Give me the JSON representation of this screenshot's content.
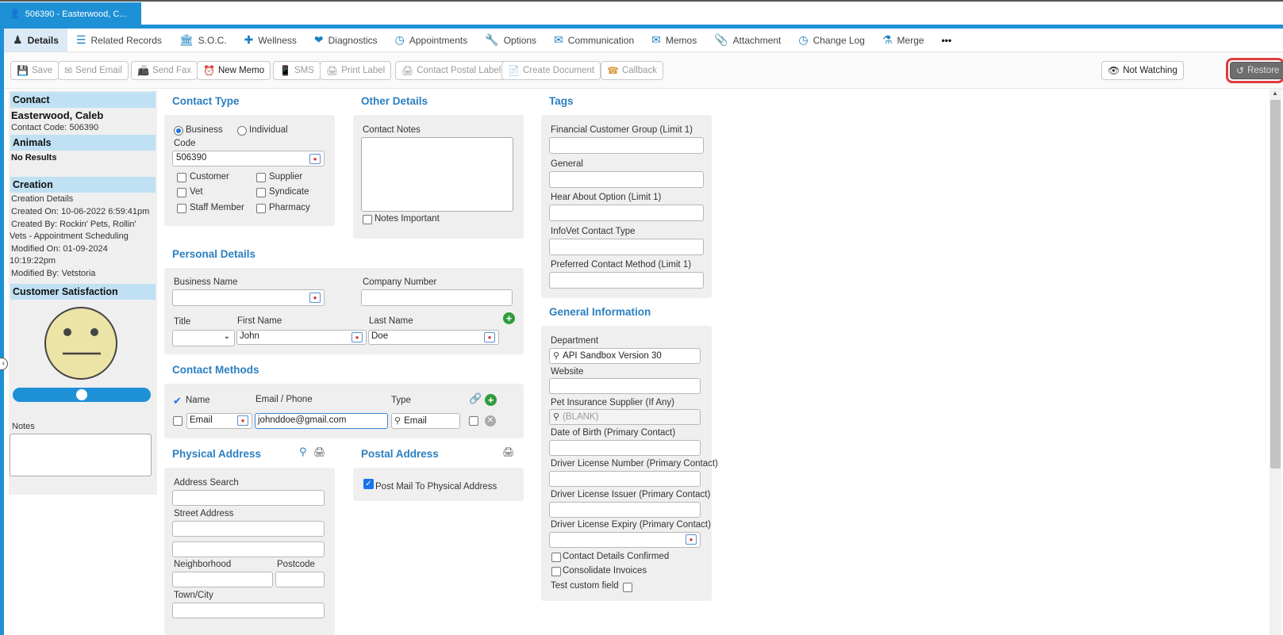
{
  "window": {
    "tab_title": "506390 - Easterwood, C..."
  },
  "nav": {
    "tabs": [
      {
        "label": "Details"
      },
      {
        "label": "Related Records"
      },
      {
        "label": "S.O.C."
      },
      {
        "label": "Wellness"
      },
      {
        "label": "Diagnostics"
      },
      {
        "label": "Appointments"
      },
      {
        "label": "Options"
      },
      {
        "label": "Communication"
      },
      {
        "label": "Memos"
      },
      {
        "label": "Attachment"
      },
      {
        "label": "Change Log"
      },
      {
        "label": "Merge"
      }
    ],
    "more": "•••"
  },
  "toolbar": {
    "save": "Save",
    "send_email": "Send Email",
    "send_fax": "Send Fax",
    "new_memo": "New Memo",
    "sms": "SMS",
    "print_label": "Print Label",
    "contact_postal_label": "Contact Postal Label",
    "create_document": "Create Document",
    "callback": "Callback",
    "not_watching": "Not Watching",
    "restore": "Restore"
  },
  "sidebar": {
    "contact_header": "Contact",
    "contact_name": "Easterwood, Caleb",
    "contact_code": "Contact Code: 506390",
    "animals_header": "Animals",
    "animals_value": "No Results",
    "creation_header": "Creation",
    "creation_lines": [
      "Creation Details",
      "Created On: 10-06-2022 6:59:41pm",
      "Created By: Rockin' Pets, Rollin'",
      "Vets - Appointment Scheduling",
      "Modified On: 01-09-2024",
      "10:19:22pm",
      "Modified By: Vetstoria"
    ],
    "satisfaction_header": "Customer Satisfaction",
    "satisfaction_level": 0.5,
    "notes_label": "Notes"
  },
  "contact_type": {
    "title": "Contact Type",
    "business": "Business",
    "individual": "Individual",
    "code_label": "Code",
    "code_value": "506390",
    "checkboxes": [
      "Customer",
      "Supplier",
      "Vet",
      "Syndicate",
      "Staff Member",
      "Pharmacy"
    ]
  },
  "other_details": {
    "title": "Other Details",
    "contact_notes_label": "Contact Notes",
    "notes_important": "Notes Important"
  },
  "tags": {
    "title": "Tags",
    "fields": [
      "Financial Customer Group (Limit 1)",
      "General",
      "Hear About Option (Limit 1)",
      "InfoVet Contact Type",
      "Preferred Contact Method (Limit 1)"
    ]
  },
  "personal": {
    "title": "Personal Details",
    "business_name": "Business Name",
    "company_number": "Company Number",
    "title_label": "Title",
    "first_name_label": "First Name",
    "first_name": "John",
    "last_name_label": "Last Name",
    "last_name": "Doe"
  },
  "contact_methods": {
    "title": "Contact Methods",
    "col_name": "Name",
    "col_email_phone": "Email / Phone",
    "col_type": "Type",
    "row": {
      "name": "Email",
      "value": "johnddoe@gmail.com",
      "type": "Email"
    }
  },
  "physical": {
    "title": "Physical Address",
    "address_search": "Address Search",
    "street_address": "Street Address",
    "neighborhood": "Neighborhood",
    "postcode": "Postcode",
    "town_city": "Town/City"
  },
  "postal": {
    "title": "Postal Address",
    "post_mail": "Post Mail To Physical Address"
  },
  "general": {
    "title": "General Information",
    "department_label": "Department",
    "department_value": "API Sandbox Version 30",
    "website_label": "Website",
    "pet_ins_label": "Pet Insurance Supplier (If Any)",
    "pet_ins_value": "(BLANK)",
    "dob_label": "Date of Birth (Primary Contact)",
    "dl_number_label": "Driver License Number (Primary Contact)",
    "dl_issuer_label": "Driver License Issuer (Primary Contact)",
    "dl_expiry_label": "Driver License Expiry (Primary Contact)",
    "contact_confirmed": "Contact Details Confirmed",
    "consolidate": "Consolidate Invoices",
    "test_custom": "Test custom field"
  }
}
